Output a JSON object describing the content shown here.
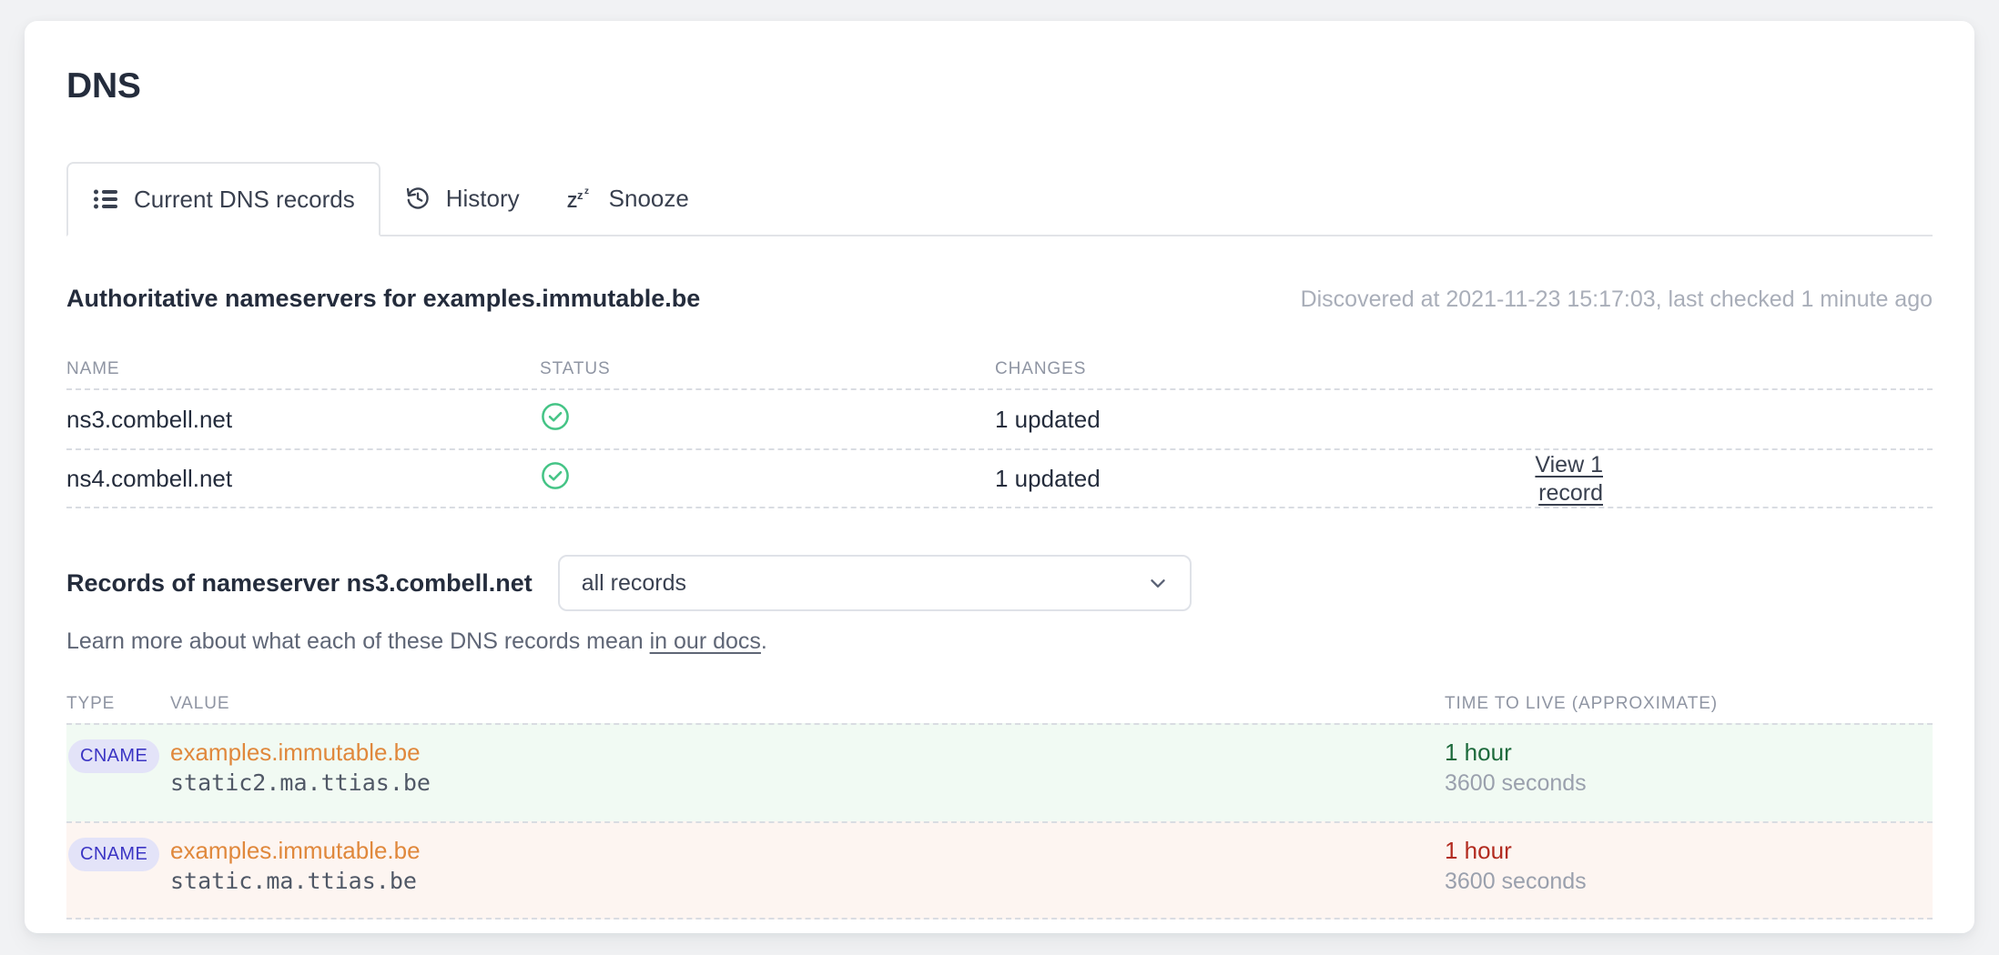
{
  "page": {
    "title": "DNS"
  },
  "tabs": [
    {
      "label": "Current DNS records",
      "icon": "list-icon",
      "active": true
    },
    {
      "label": "History",
      "icon": "clock-rewind-icon",
      "active": false
    },
    {
      "label": "Snooze",
      "icon": "snooze-zzz-icon",
      "active": false
    }
  ],
  "nameservers": {
    "heading": "Authoritative nameservers for examples.immutable.be",
    "meta": "Discovered at 2021-11-23 15:17:03, last checked 1 minute ago",
    "columns": [
      "NAME",
      "STATUS",
      "CHANGES"
    ],
    "rows": [
      {
        "name": "ns3.combell.net",
        "status": "ok",
        "changes": "1 updated",
        "action": ""
      },
      {
        "name": "ns4.combell.net",
        "status": "ok",
        "changes": "1 updated",
        "action": "View 1 record"
      }
    ]
  },
  "records": {
    "heading": "Records of nameserver ns3.combell.net",
    "filter_value": "all records",
    "filter_options": [
      "all records"
    ],
    "learn_more_prefix": "Learn more about what each of these DNS records mean ",
    "learn_more_link": "in our docs",
    "learn_more_suffix": ".",
    "columns": [
      "TYPE",
      "VALUE",
      "TIME TO LIVE (APPROXIMATE)"
    ],
    "rows": [
      {
        "type": "CNAME",
        "host": "examples.immutable.be",
        "target": "static2.ma.ttias.be",
        "ttl": "1 hour",
        "ttl_seconds": "3600 seconds",
        "state": "added"
      },
      {
        "type": "CNAME",
        "host": "examples.immutable.be",
        "target": "static.ma.ttias.be",
        "ttl": "1 hour",
        "ttl_seconds": "3600 seconds",
        "state": "removed"
      }
    ]
  },
  "colors": {
    "page_background": "#f1f2f4",
    "text_primary": "#242c3c",
    "text_muted": "#8f95a3",
    "status_ok": "#45c486",
    "badge_background": "#e3e3f8",
    "badge_text": "#3b35c4",
    "record_host": "#e0883c",
    "row_added": "#f1faf3",
    "row_removed": "#fdf5f1",
    "ttl_added": "#1d6a3c",
    "ttl_removed": "#b22b20"
  }
}
